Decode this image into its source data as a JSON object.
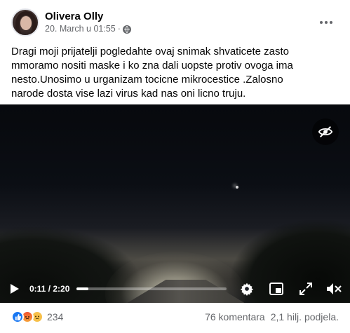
{
  "post": {
    "author": "Olivera Olly",
    "time": "20. March u 01:55",
    "dot": "·",
    "text": "Dragi moji prijatelji pogledahte ovaj snimak shvaticete zasto mmoramo nositi maske i ko zna dali uopste protiv ovoga ima nesto.Unosimo u urganizam tocicne mikrocestice .Zalosno narode dosta vise lazi virus kad nas oni licno truju."
  },
  "video": {
    "current_time": "0:11",
    "duration": "2:20",
    "time_display": "0:11 / 2:20",
    "progress_fraction": 0.079
  },
  "footer": {
    "reaction_count": "234",
    "comments": "76 komentara",
    "shares": "2,1 hilj. podjela."
  },
  "icons": {
    "privacy": "globe-icon",
    "more": "more-options-icon",
    "hide": "eye-slash-icon",
    "play": "play-icon",
    "settings": "gear-icon",
    "pip": "picture-in-picture-icon",
    "fullscreen": "fullscreen-icon",
    "mute": "volume-muted-icon"
  },
  "colors": {
    "accent": "#1877f2",
    "secondary_text": "#65676b"
  }
}
